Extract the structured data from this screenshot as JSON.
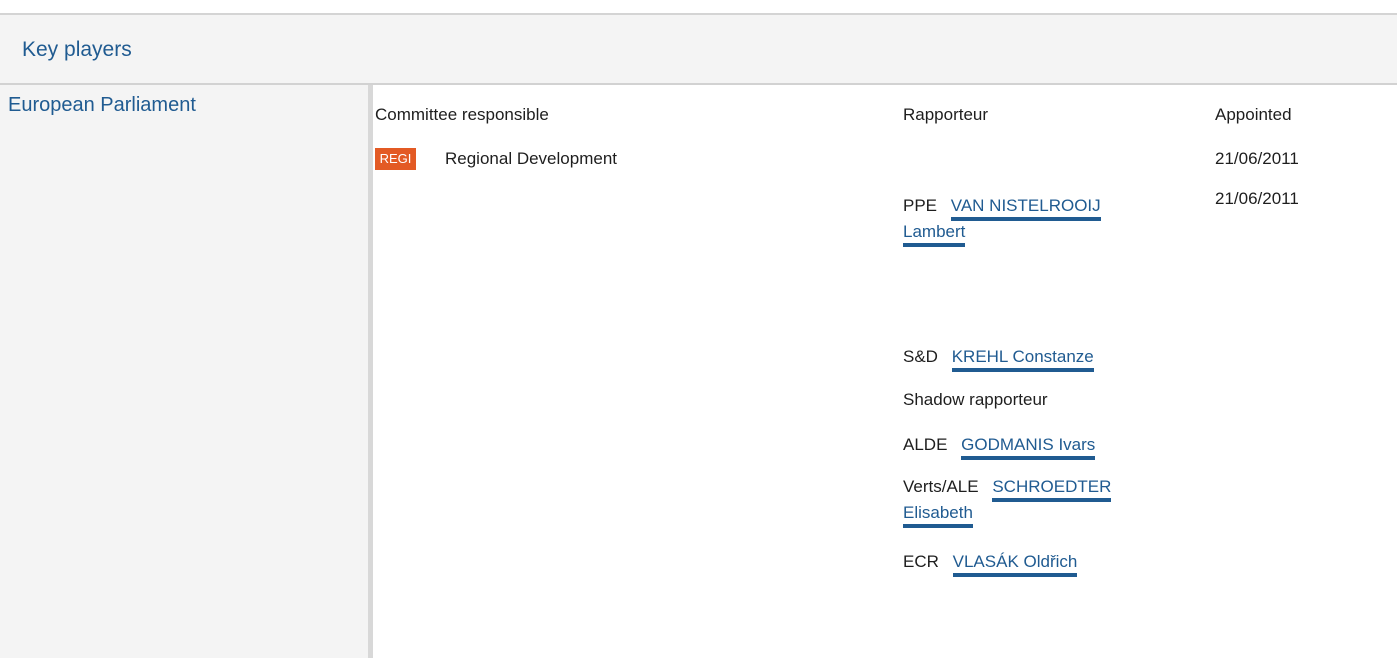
{
  "panel": {
    "title": "Key players"
  },
  "org": {
    "name": "European Parliament"
  },
  "headers": {
    "committee": "Committee responsible",
    "rapporteur": "Rapporteur",
    "appointed": "Appointed"
  },
  "committee": {
    "badge": "REGI",
    "name": "Regional Development",
    "date": "21/06/2011"
  },
  "rapporteurs": [
    {
      "group": "PPE",
      "name_line1": "VAN NISTELROOIJ",
      "name_line2": "Lambert",
      "date": "21/06/2011"
    },
    {
      "group": "S&D",
      "name": "KREHL Constanze"
    }
  ],
  "shadow": {
    "label": "Shadow rapporteur",
    "items": [
      {
        "group": "ALDE",
        "name": "GODMANIS Ivars"
      },
      {
        "group": "Verts/ALE",
        "name_line1": "SCHROEDTER",
        "name_line2": "Elisabeth"
      },
      {
        "group": "ECR",
        "name": "VLASÁK Oldřich"
      }
    ]
  },
  "colors": {
    "accent": "#205b91",
    "badge": "#e35a24",
    "panel_bg": "#f4f4f4"
  }
}
